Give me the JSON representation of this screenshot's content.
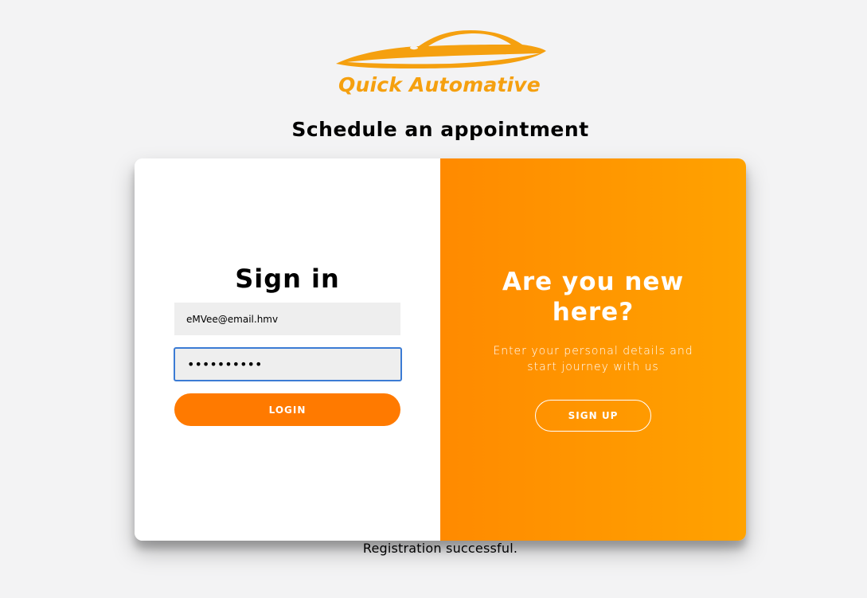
{
  "brand": {
    "name": "Quick Automative",
    "color": "#f5a00f"
  },
  "page": {
    "title": "Schedule an appointment"
  },
  "signin": {
    "title": "Sign in",
    "email_value": "eMVee@email.hmv",
    "password_value": "••••••••••",
    "login_label": "LOGIN"
  },
  "signup_panel": {
    "title": "Are you new here?",
    "text": "Enter your personal details and start journey with us",
    "button_label": "SIGN UP",
    "gradient_start": "#ff8a00",
    "gradient_end": "#ffa200"
  },
  "status": {
    "message": "Registration successful."
  },
  "icons": {
    "logo": "car-logo-icon"
  }
}
